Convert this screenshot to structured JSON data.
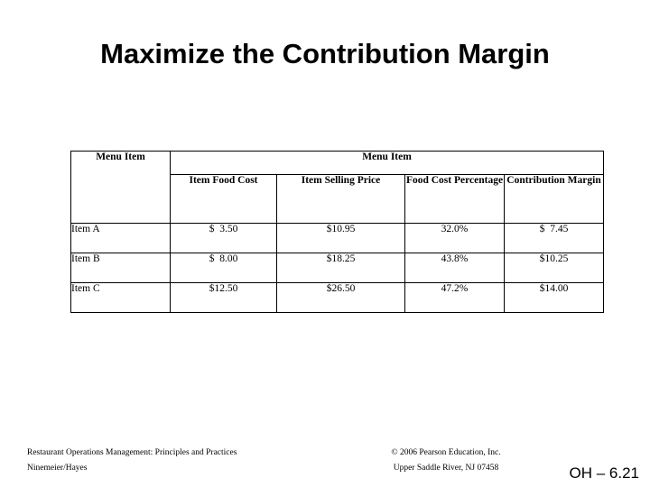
{
  "slide": {
    "title": "Maximize the Contribution Margin",
    "number": "OH – 6.21"
  },
  "table": {
    "group_header": "Menu Item",
    "stub_header": "Menu Item",
    "columns": [
      "Item Food Cost",
      "Item Selling Price",
      "Food Cost Percentage",
      "Contribution Margin"
    ],
    "rows": [
      {
        "label": "Item A",
        "item_food_cost": "$  3.50",
        "item_selling_price": "$10.95",
        "food_cost_percentage": "32.0%",
        "contribution_margin": "$  7.45"
      },
      {
        "label": "Item B",
        "item_food_cost": "$  8.00",
        "item_selling_price": "$18.25",
        "food_cost_percentage": "43.8%",
        "contribution_margin": "$10.25"
      },
      {
        "label": "Item C",
        "item_food_cost": "$12.50",
        "item_selling_price": "$26.50",
        "food_cost_percentage": "47.2%",
        "contribution_margin": "$14.00"
      }
    ]
  },
  "footer": {
    "book_title": "Restaurant Operations Management: Principles and Practices",
    "authors": "Ninemeier/Hayes",
    "copyright": "© 2006 Pearson Education, Inc.",
    "address": "Upper Saddle River, NJ 07458"
  }
}
